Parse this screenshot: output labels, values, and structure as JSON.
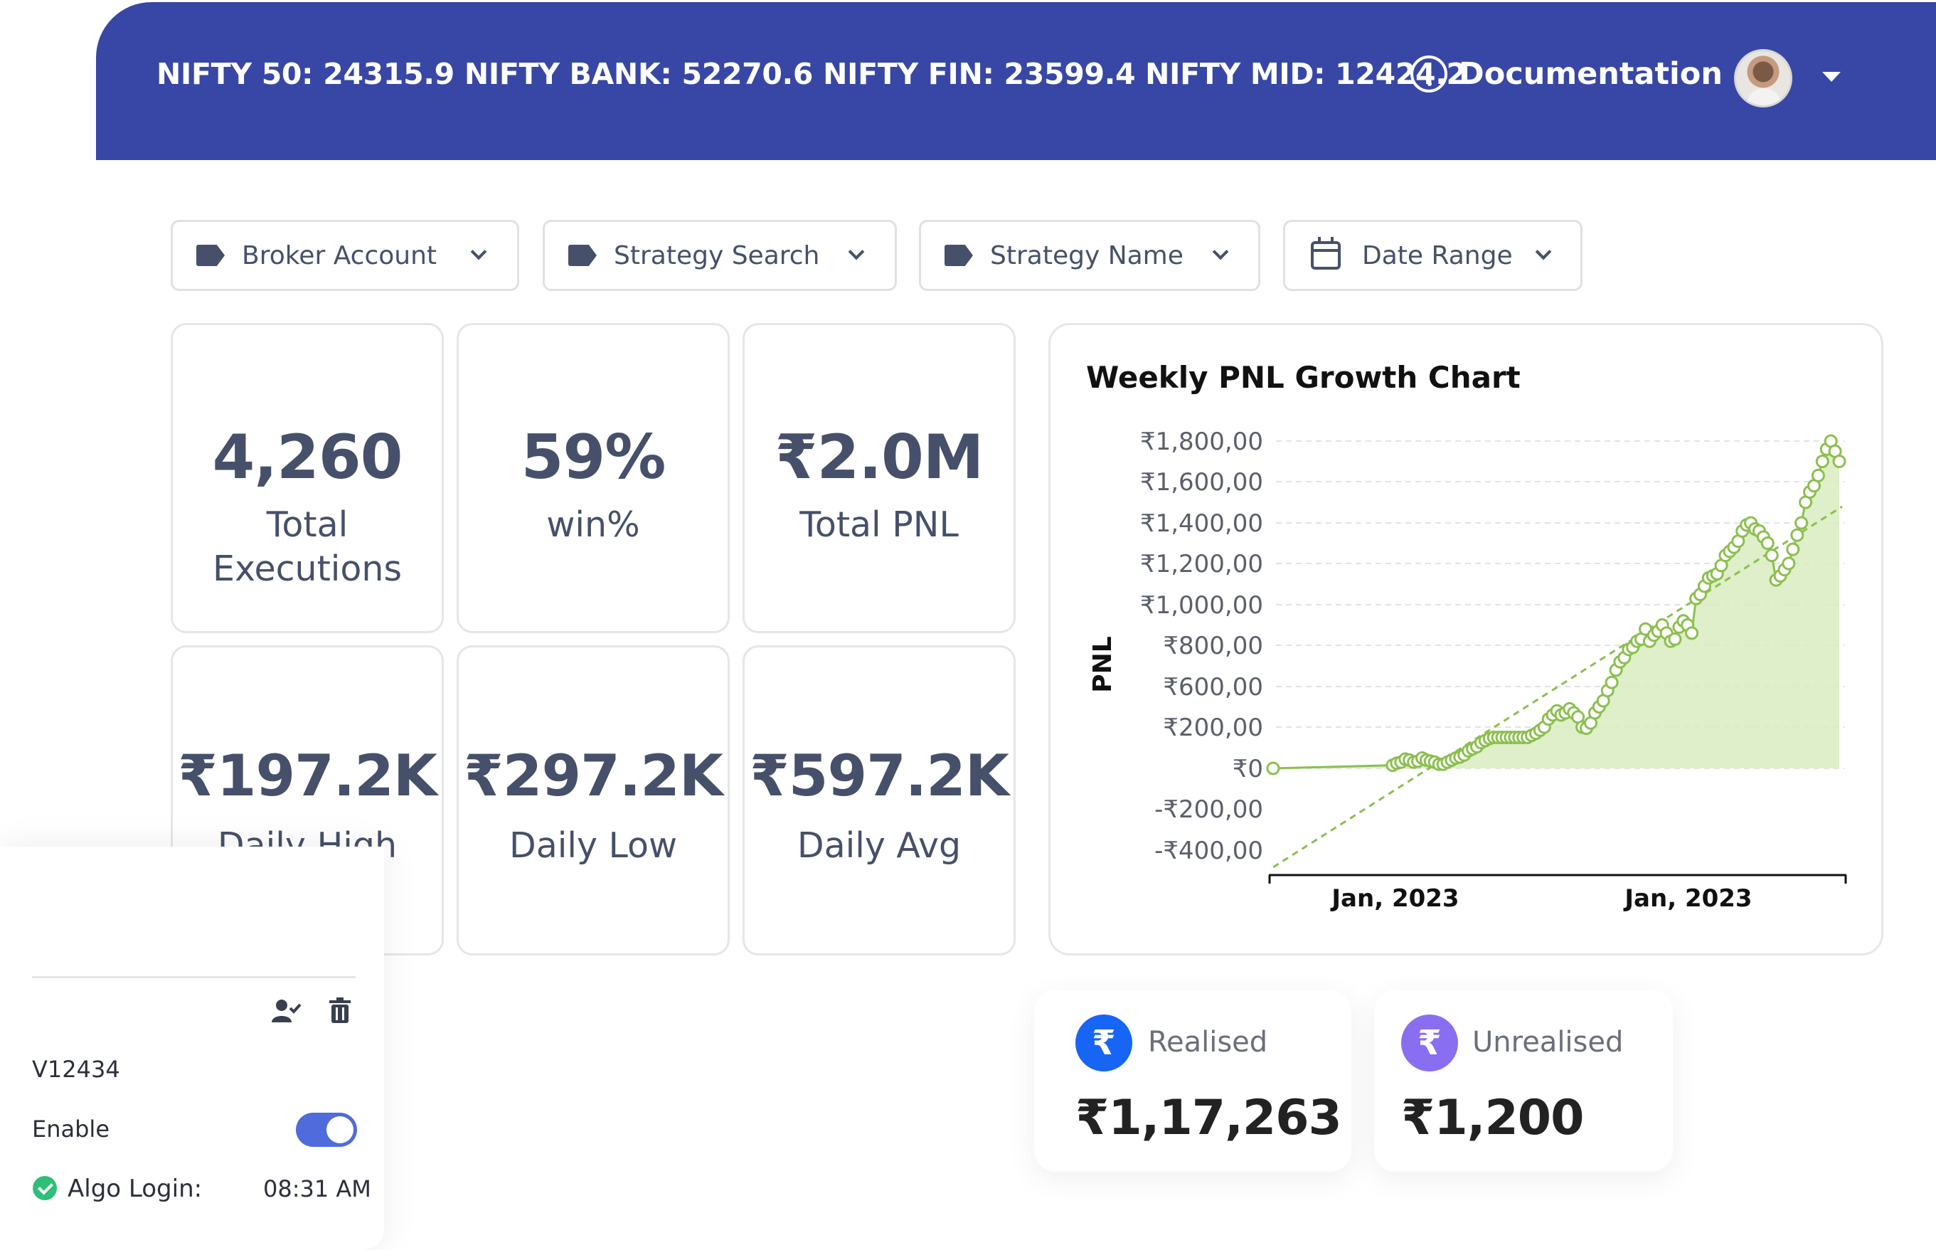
{
  "header": {
    "ticker": "NIFTY 50: 24315.9 NIFTY BANK: 52270.6 NIFTY FIN: 23599.4 NIFTY MID: 12424.2",
    "documentation_label": "Documentation"
  },
  "filters": [
    {
      "label": "Broker Account",
      "icon": "tag-icon"
    },
    {
      "label": "Strategy Search",
      "icon": "tag-icon"
    },
    {
      "label": "Strategy Name",
      "icon": "tag-icon"
    },
    {
      "label": "Date Range",
      "icon": "calendar-icon"
    }
  ],
  "stats": [
    {
      "value": "4,260",
      "label_line1": "Total",
      "label_line2": "Executions"
    },
    {
      "value": "59%",
      "label_line1": "win%"
    },
    {
      "value": "₹2.0M",
      "label_line1": "Total PNL"
    },
    {
      "value": "₹197.2K",
      "label_line1": "Daily High"
    },
    {
      "value": "₹297.2K",
      "label_line1": "Daily Low"
    },
    {
      "value": "₹597.2K",
      "label_line1": "Daily Avg"
    }
  ],
  "chart": {
    "title": "Weekly PNL Growth Chart",
    "ylabel": "PNL",
    "x_ticks": [
      "Jan, 2023",
      "Jan, 2023"
    ]
  },
  "chart_data": {
    "type": "area",
    "title": "Weekly PNL Growth Chart",
    "xlabel": "",
    "ylabel": "PNL",
    "ylim": [
      -400000,
      1800000
    ],
    "y_ticks": [
      "₹1,800,00",
      "₹1,600,00",
      "₹1,400,00",
      "₹1,200,00",
      "₹1,000,00",
      "₹800,00",
      "₹600,00",
      "₹200,00",
      "₹0",
      "-₹200,00",
      "-₹400,00"
    ],
    "y_tick_values": [
      1800000,
      1600000,
      1400000,
      1200000,
      1000000,
      800000,
      600000,
      400000,
      0,
      -200000,
      -400000
    ],
    "x_ticks": [
      "Jan, 2023",
      "Jan, 2023"
    ],
    "grid": true,
    "series": [
      {
        "values": [
          0,
          30000,
          50000,
          60000,
          90000,
          80000,
          60000,
          70000,
          100000,
          80000,
          70000,
          60000,
          40000,
          40000,
          60000,
          80000,
          100000,
          110000,
          130000,
          170000,
          190000,
          210000,
          250000,
          270000,
          290000,
          300000,
          300000,
          300000,
          300000,
          300000,
          300000,
          300000,
          300000,
          300000,
          320000,
          340000,
          370000,
          400000,
          440000,
          460000,
          480000,
          460000,
          470000,
          490000,
          470000,
          450000,
          400000,
          390000,
          420000,
          470000,
          500000,
          530000,
          580000,
          620000,
          680000,
          720000,
          740000,
          780000,
          790000,
          820000,
          830000,
          880000,
          820000,
          850000,
          870000,
          900000,
          860000,
          820000,
          830000,
          890000,
          920000,
          900000,
          860000,
          1030000,
          1050000,
          1090000,
          1130000,
          1140000,
          1150000,
          1190000,
          1240000,
          1260000,
          1280000,
          1310000,
          1360000,
          1390000,
          1400000,
          1370000,
          1360000,
          1330000,
          1300000,
          1240000,
          1120000,
          1140000,
          1170000,
          1200000,
          1270000,
          1340000,
          1400000,
          1500000,
          1550000,
          1580000,
          1630000,
          1700000,
          1760000,
          1800000,
          1750000,
          1700000
        ]
      }
    ]
  },
  "summary": {
    "realised": {
      "label": "Realised",
      "value": "₹1,17,263",
      "color": "#1665f5"
    },
    "unrealised": {
      "label": "Unrealised",
      "value": "₹1,200",
      "color": "#8a6ef1"
    }
  },
  "account": {
    "id": "V12434",
    "enable_label": "Enable",
    "algo_login_label": "Algo Login:",
    "algo_login_time": "08:31 AM"
  },
  "colors": {
    "header_bg": "#3847a5",
    "series_line": "#8cbf4f",
    "series_fill": "#d8ecbf",
    "toggle_on": "#4f6bdc",
    "status_ok": "#2ebf78"
  }
}
